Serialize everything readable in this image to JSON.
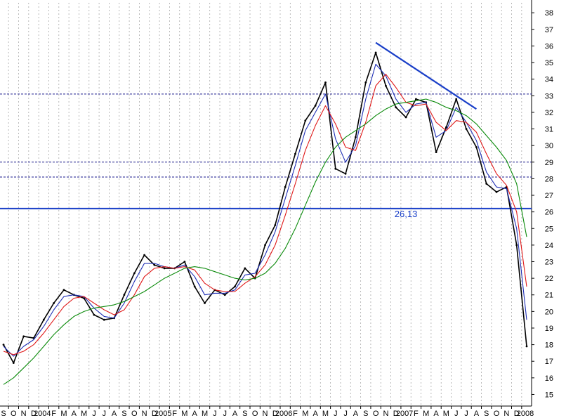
{
  "chart_data": {
    "type": "line",
    "title": "",
    "xlabel": "",
    "ylabel": "",
    "x_start": "2003-09",
    "x_end": "2008-01",
    "ylim": [
      14.3,
      38.6
    ],
    "y_ticks": [
      15,
      16,
      17,
      18,
      19,
      20,
      21,
      22,
      23,
      24,
      25,
      26,
      27,
      28,
      29,
      30,
      31,
      32,
      33,
      34,
      35,
      36,
      37,
      38
    ],
    "x_tick_labels": [
      "S",
      "O",
      "N",
      "D",
      "2004",
      "F",
      "M",
      "A",
      "M",
      "J",
      "J",
      "A",
      "S",
      "O",
      "N",
      "D",
      "2005",
      "F",
      "M",
      "A",
      "M",
      "J",
      "J",
      "A",
      "S",
      "O",
      "N",
      "D",
      "2006",
      "F",
      "M",
      "A",
      "M",
      "J",
      "J",
      "A",
      "S",
      "O",
      "N",
      "D",
      "2007",
      "F",
      "M",
      "A",
      "M",
      "J",
      "J",
      "A",
      "S",
      "O",
      "N",
      "D",
      "2008"
    ],
    "grid": true,
    "legend": "none",
    "series": [
      {
        "role": "price",
        "color": "#000000",
        "points": [
          [
            "2003-09",
            18.0
          ],
          [
            "2003-10",
            16.9
          ],
          [
            "2003-11",
            18.5
          ],
          [
            "2003-12",
            18.4
          ],
          [
            "2004-01",
            19.5
          ],
          [
            "2004-02",
            20.5
          ],
          [
            "2004-03",
            21.3
          ],
          [
            "2004-04",
            21.0
          ],
          [
            "2004-05",
            20.8
          ],
          [
            "2004-06",
            19.8
          ],
          [
            "2004-07",
            19.5
          ],
          [
            "2004-08",
            19.6
          ],
          [
            "2004-09",
            21.0
          ],
          [
            "2004-10",
            22.3
          ],
          [
            "2004-11",
            23.4
          ],
          [
            "2004-12",
            22.8
          ],
          [
            "2005-01",
            22.6
          ],
          [
            "2005-02",
            22.6
          ],
          [
            "2005-03",
            23.0
          ],
          [
            "2005-04",
            21.5
          ],
          [
            "2005-05",
            20.5
          ],
          [
            "2005-06",
            21.3
          ],
          [
            "2005-07",
            21.0
          ],
          [
            "2005-08",
            21.5
          ],
          [
            "2005-09",
            22.6
          ],
          [
            "2005-10",
            22.0
          ],
          [
            "2005-11",
            24.0
          ],
          [
            "2005-12",
            25.2
          ],
          [
            "2006-01",
            27.5
          ],
          [
            "2006-02",
            29.5
          ],
          [
            "2006-03",
            31.5
          ],
          [
            "2006-04",
            32.4
          ],
          [
            "2006-05",
            33.8
          ],
          [
            "2006-06",
            28.6
          ],
          [
            "2006-07",
            28.3
          ],
          [
            "2006-08",
            30.5
          ],
          [
            "2006-09",
            33.8
          ],
          [
            "2006-10",
            35.6
          ],
          [
            "2006-11",
            33.6
          ],
          [
            "2006-12",
            32.3
          ],
          [
            "2007-01",
            31.7
          ],
          [
            "2007-02",
            32.8
          ],
          [
            "2007-03",
            32.6
          ],
          [
            "2007-04",
            29.6
          ],
          [
            "2007-05",
            31.1
          ],
          [
            "2007-06",
            32.8
          ],
          [
            "2007-07",
            31.0
          ],
          [
            "2007-08",
            29.9
          ],
          [
            "2007-09",
            27.7
          ],
          [
            "2007-10",
            27.2
          ],
          [
            "2007-11",
            27.5
          ],
          [
            "2007-12",
            24.0
          ],
          [
            "2008-01",
            17.9
          ]
        ]
      },
      {
        "role": "moving-average-short",
        "color": "#1f2fb5",
        "points": [
          [
            "2003-09",
            17.9
          ],
          [
            "2003-10",
            17.3
          ],
          [
            "2003-11",
            17.9
          ],
          [
            "2003-12",
            18.3
          ],
          [
            "2004-01",
            19.1
          ],
          [
            "2004-02",
            20.1
          ],
          [
            "2004-03",
            20.9
          ],
          [
            "2004-04",
            21.0
          ],
          [
            "2004-05",
            20.9
          ],
          [
            "2004-06",
            20.2
          ],
          [
            "2004-07",
            19.7
          ],
          [
            "2004-08",
            19.6
          ],
          [
            "2004-09",
            20.5
          ],
          [
            "2004-10",
            21.8
          ],
          [
            "2004-11",
            22.9
          ],
          [
            "2004-12",
            22.9
          ],
          [
            "2005-01",
            22.7
          ],
          [
            "2005-02",
            22.6
          ],
          [
            "2005-03",
            22.8
          ],
          [
            "2005-04",
            22.1
          ],
          [
            "2005-05",
            21.0
          ],
          [
            "2005-06",
            21.1
          ],
          [
            "2005-07",
            21.1
          ],
          [
            "2005-08",
            21.3
          ],
          [
            "2005-09",
            22.2
          ],
          [
            "2005-10",
            22.3
          ],
          [
            "2005-11",
            23.4
          ],
          [
            "2005-12",
            24.8
          ],
          [
            "2006-01",
            26.8
          ],
          [
            "2006-02",
            28.8
          ],
          [
            "2006-03",
            30.9
          ],
          [
            "2006-04",
            32.0
          ],
          [
            "2006-05",
            33.1
          ],
          [
            "2006-06",
            30.4
          ],
          [
            "2006-07",
            29.0
          ],
          [
            "2006-08",
            30.0
          ],
          [
            "2006-09",
            32.8
          ],
          [
            "2006-10",
            34.9
          ],
          [
            "2006-11",
            34.2
          ],
          [
            "2006-12",
            32.8
          ],
          [
            "2007-01",
            32.0
          ],
          [
            "2007-02",
            32.5
          ],
          [
            "2007-03",
            32.6
          ],
          [
            "2007-04",
            30.5
          ],
          [
            "2007-05",
            30.9
          ],
          [
            "2007-06",
            32.3
          ],
          [
            "2007-07",
            31.4
          ],
          [
            "2007-08",
            30.3
          ],
          [
            "2007-09",
            28.4
          ],
          [
            "2007-10",
            27.5
          ],
          [
            "2007-11",
            27.4
          ],
          [
            "2007-12",
            25.0
          ],
          [
            "2008-01",
            19.5
          ]
        ]
      },
      {
        "role": "moving-average-medium",
        "color": "#e01919",
        "points": [
          [
            "2003-09",
            17.6
          ],
          [
            "2003-10",
            17.4
          ],
          [
            "2003-11",
            17.6
          ],
          [
            "2003-12",
            18.0
          ],
          [
            "2004-01",
            18.7
          ],
          [
            "2004-02",
            19.5
          ],
          [
            "2004-03",
            20.3
          ],
          [
            "2004-04",
            20.8
          ],
          [
            "2004-05",
            20.9
          ],
          [
            "2004-06",
            20.5
          ],
          [
            "2004-07",
            20.1
          ],
          [
            "2004-08",
            19.8
          ],
          [
            "2004-09",
            20.1
          ],
          [
            "2004-10",
            21.0
          ],
          [
            "2004-11",
            22.1
          ],
          [
            "2004-12",
            22.6
          ],
          [
            "2005-01",
            22.7
          ],
          [
            "2005-02",
            22.6
          ],
          [
            "2005-03",
            22.7
          ],
          [
            "2005-04",
            22.5
          ],
          [
            "2005-05",
            21.7
          ],
          [
            "2005-06",
            21.3
          ],
          [
            "2005-07",
            21.2
          ],
          [
            "2005-08",
            21.2
          ],
          [
            "2005-09",
            21.7
          ],
          [
            "2005-10",
            22.1
          ],
          [
            "2005-11",
            22.8
          ],
          [
            "2005-12",
            24.0
          ],
          [
            "2006-01",
            25.8
          ],
          [
            "2006-02",
            27.7
          ],
          [
            "2006-03",
            29.7
          ],
          [
            "2006-04",
            31.2
          ],
          [
            "2006-05",
            32.4
          ],
          [
            "2006-06",
            31.3
          ],
          [
            "2006-07",
            29.9
          ],
          [
            "2006-08",
            29.7
          ],
          [
            "2006-09",
            31.4
          ],
          [
            "2006-10",
            33.6
          ],
          [
            "2006-11",
            34.3
          ],
          [
            "2006-12",
            33.5
          ],
          [
            "2007-01",
            32.6
          ],
          [
            "2007-02",
            32.4
          ],
          [
            "2007-03",
            32.5
          ],
          [
            "2007-04",
            31.4
          ],
          [
            "2007-05",
            30.9
          ],
          [
            "2007-06",
            31.5
          ],
          [
            "2007-07",
            31.4
          ],
          [
            "2007-08",
            30.8
          ],
          [
            "2007-09",
            29.5
          ],
          [
            "2007-10",
            28.3
          ],
          [
            "2007-11",
            27.6
          ],
          [
            "2007-12",
            26.0
          ],
          [
            "2008-01",
            21.5
          ]
        ]
      },
      {
        "role": "moving-average-long",
        "color": "#0a8a0a",
        "points": [
          [
            "2003-09",
            15.6
          ],
          [
            "2003-10",
            16.0
          ],
          [
            "2003-11",
            16.6
          ],
          [
            "2003-12",
            17.2
          ],
          [
            "2004-01",
            17.9
          ],
          [
            "2004-02",
            18.6
          ],
          [
            "2004-03",
            19.2
          ],
          [
            "2004-04",
            19.7
          ],
          [
            "2004-05",
            20.0
          ],
          [
            "2004-06",
            20.2
          ],
          [
            "2004-07",
            20.3
          ],
          [
            "2004-08",
            20.4
          ],
          [
            "2004-09",
            20.6
          ],
          [
            "2004-10",
            20.9
          ],
          [
            "2004-11",
            21.2
          ],
          [
            "2004-12",
            21.6
          ],
          [
            "2005-01",
            22.0
          ],
          [
            "2005-02",
            22.3
          ],
          [
            "2005-03",
            22.6
          ],
          [
            "2005-04",
            22.7
          ],
          [
            "2005-05",
            22.6
          ],
          [
            "2005-06",
            22.4
          ],
          [
            "2005-07",
            22.2
          ],
          [
            "2005-08",
            22.0
          ],
          [
            "2005-09",
            21.9
          ],
          [
            "2005-10",
            22.0
          ],
          [
            "2005-11",
            22.3
          ],
          [
            "2005-12",
            22.9
          ],
          [
            "2006-01",
            23.8
          ],
          [
            "2006-02",
            25.0
          ],
          [
            "2006-03",
            26.4
          ],
          [
            "2006-04",
            27.8
          ],
          [
            "2006-05",
            29.0
          ],
          [
            "2006-06",
            29.9
          ],
          [
            "2006-07",
            30.5
          ],
          [
            "2006-08",
            30.9
          ],
          [
            "2006-09",
            31.3
          ],
          [
            "2006-10",
            31.8
          ],
          [
            "2006-11",
            32.2
          ],
          [
            "2006-12",
            32.5
          ],
          [
            "2007-01",
            32.6
          ],
          [
            "2007-02",
            32.7
          ],
          [
            "2007-03",
            32.8
          ],
          [
            "2007-04",
            32.6
          ],
          [
            "2007-05",
            32.3
          ],
          [
            "2007-06",
            32.1
          ],
          [
            "2007-07",
            31.8
          ],
          [
            "2007-08",
            31.3
          ],
          [
            "2007-09",
            30.6
          ],
          [
            "2007-10",
            29.9
          ],
          [
            "2007-11",
            29.1
          ],
          [
            "2007-12",
            27.7
          ],
          [
            "2008-01",
            24.5
          ]
        ]
      }
    ],
    "horizontal_lines": [
      {
        "y": 33.1,
        "style": "dashed",
        "color": "#1a1a8c"
      },
      {
        "y": 29.0,
        "style": "dashed",
        "color": "#1a1a8c"
      },
      {
        "y": 28.1,
        "style": "dashed",
        "color": "#1a1a8c"
      },
      {
        "y": 26.2,
        "style": "solid",
        "color": "#1a3fc8"
      }
    ],
    "trendline": {
      "from": [
        "2006-10",
        36.2
      ],
      "to": [
        "2007-08",
        32.2
      ],
      "color": "#1a3fc8"
    },
    "annotations": [
      {
        "text": "26,13",
        "x": "2007-01",
        "y": 25.9,
        "color": "#1a3fc8"
      }
    ]
  }
}
